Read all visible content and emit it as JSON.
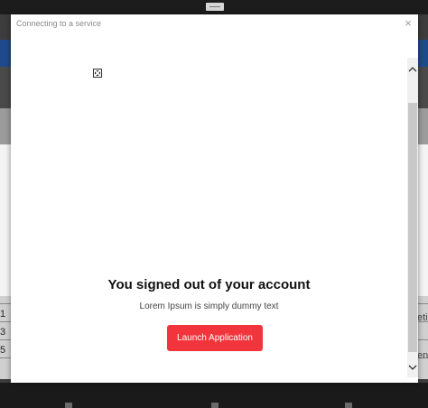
{
  "modal": {
    "title": "Connecting to a service",
    "close_glyph": "×",
    "heading": "You signed out of your account",
    "subtext": "Lorem Ipsum is simply dummy text",
    "launch_button_label": "Launch Application",
    "accent_color": "#f2343c"
  },
  "scrollbar": {
    "up_glyph": "︿",
    "down_glyph": "﹀"
  },
  "background": {
    "row_labels": [
      "1",
      "3",
      "5"
    ],
    "right_fragments": [
      "eti",
      "ene"
    ]
  },
  "icons": [
    "close-icon",
    "broken-image-icon",
    "chevron-up-icon",
    "chevron-down-icon",
    "grip-icon"
  ]
}
